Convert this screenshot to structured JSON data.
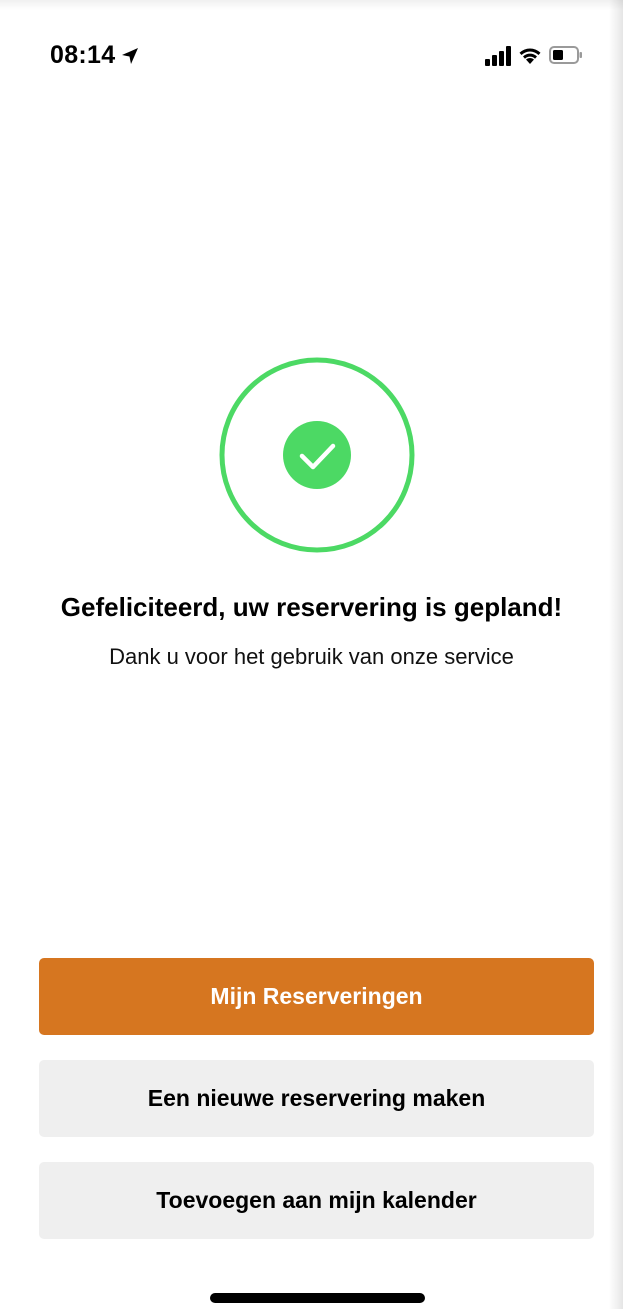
{
  "status_bar": {
    "time": "08:14",
    "icons": [
      "location-arrow-icon",
      "signal-bars-icon",
      "wifi-icon",
      "battery-icon"
    ]
  },
  "success": {
    "icon": "checkmark-circle-icon",
    "title": "Gefeliciteerd, uw reservering is gepland!",
    "subtitle": "Dank u voor het gebruik van onze service"
  },
  "actions": {
    "my_reservations_label": "Mijn Reserveringen",
    "new_reservation_label": "Een nieuwe reservering maken",
    "add_to_calendar_label": "Toevoegen aan mijn kalender"
  },
  "colors": {
    "accent_orange": "#d67620",
    "success_green": "#4cd964",
    "secondary_button_bg": "#efefef"
  }
}
